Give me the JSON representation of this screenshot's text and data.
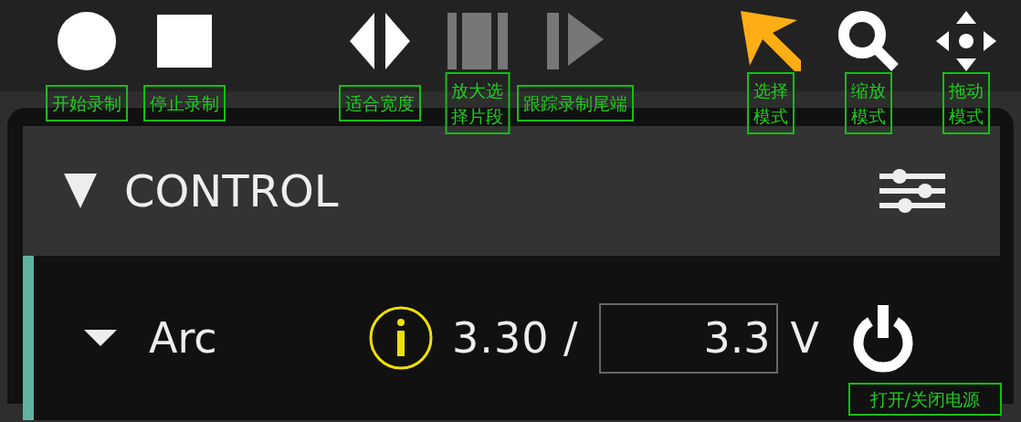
{
  "toolbar": {
    "groups": [
      [
        {
          "kind": "record",
          "label": "开始录制",
          "disabled": false,
          "selected": false
        },
        {
          "kind": "stop",
          "label": "停止录制",
          "disabled": false,
          "selected": false
        }
      ],
      [
        {
          "kind": "fit",
          "label": "适合宽度",
          "disabled": false,
          "selected": false
        },
        {
          "kind": "zoom-selection",
          "label": "放大选择片段",
          "disabled": true,
          "selected": false
        },
        {
          "kind": "follow",
          "label": "跟踪录制尾端",
          "disabled": true,
          "selected": false
        }
      ],
      [
        {
          "kind": "select",
          "label": "选择模式",
          "disabled": false,
          "selected": true
        },
        {
          "kind": "zoom",
          "label": "缩放模式",
          "disabled": false,
          "selected": false
        },
        {
          "kind": "pan",
          "label": "拖动模式",
          "disabled": false,
          "selected": false
        }
      ]
    ]
  },
  "panel": {
    "title": "CONTROL",
    "expanded": true,
    "rows": [
      {
        "name": "Arc",
        "expanded": true,
        "reading": "3.30 /",
        "value": "3.3",
        "unit": "V",
        "power_tooltip": "打开/关闭电源"
      }
    ]
  }
}
